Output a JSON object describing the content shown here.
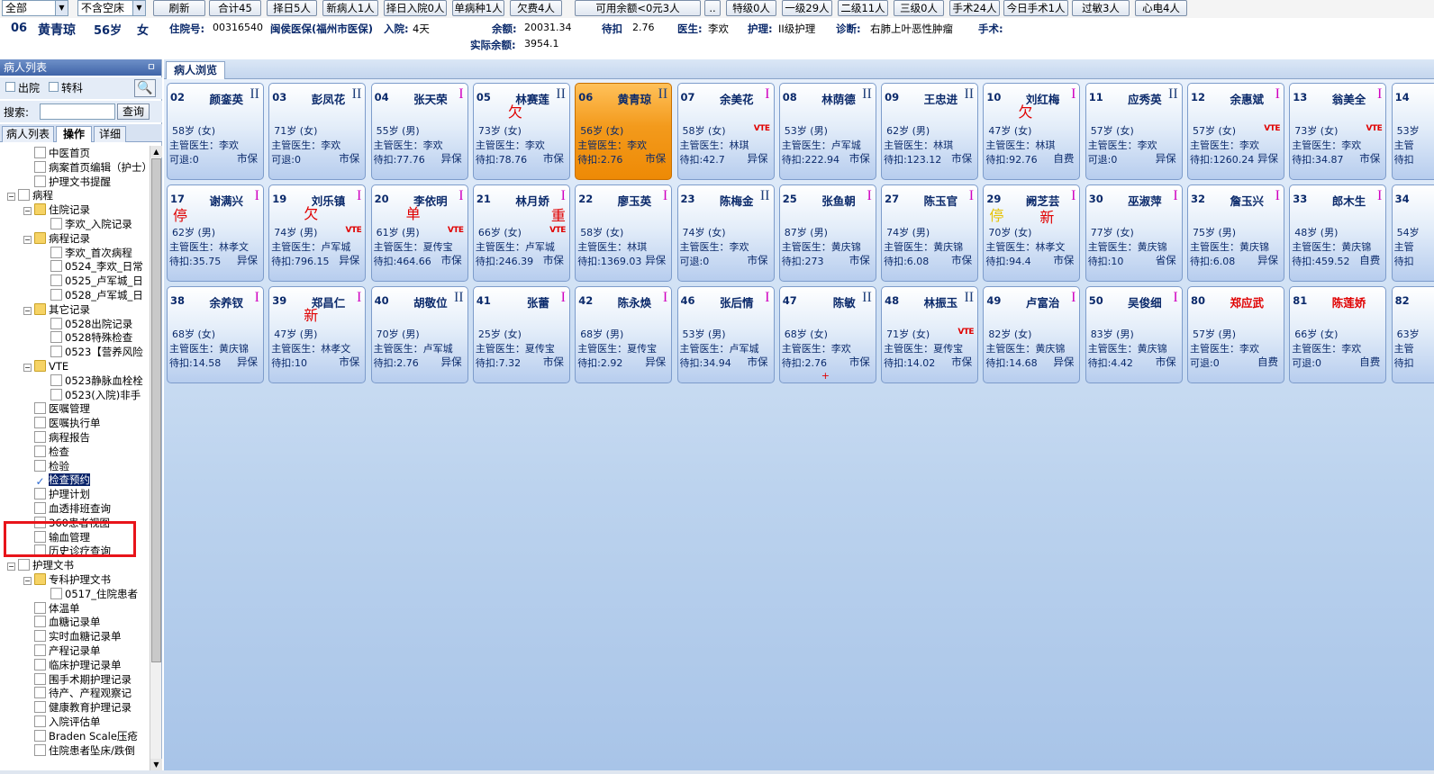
{
  "toolbar": {
    "filter_all": "全部",
    "filter_bed": "不含空床",
    "buttons": [
      "刷新",
      "合计45",
      "择日5人",
      "新病人1人",
      "择日入院0人",
      "单病种1人",
      "欠费4人",
      "可用余额<0元3人",
      "..",
      "特级0人",
      "一级29人",
      "二级11人",
      "三级0人",
      "手术24人",
      "今日手术1人",
      "过敏3人",
      "心电4人"
    ]
  },
  "patient_info": {
    "bed": "06",
    "name": "黄青琼",
    "age": "56岁",
    "sex": "女",
    "admission_label": "住院号:",
    "admission_no": "00316540",
    "insurance": "闽侯医保(福州市医保)",
    "admit_label": "入院:",
    "admit_days": "4天",
    "balance_label": "余额:",
    "balance": "20031.34",
    "actual_balance_label": "实际余额:",
    "actual_balance": "3954.1",
    "pending_label": "待扣",
    "pending": "2.76",
    "doctor_label": "医生:",
    "doctor": "李欢",
    "nursing_label": "护理:",
    "nursing": "II级护理",
    "diagnosis_label": "诊断:",
    "diagnosis": "右肺上叶恶性肿瘤",
    "surgery_label": "手术:"
  },
  "left_panel": {
    "title": "病人列表",
    "pin": "ㅁ",
    "discharged": "出院",
    "transferred": "转科",
    "search_label": "搜索:",
    "search_button": "查询",
    "tabs": [
      "病人列表",
      "操作",
      "详细"
    ],
    "tree": [
      {
        "label": "中医首页",
        "exp": ""
      },
      {
        "label": "病案首页编辑（护士）",
        "exp": ""
      },
      {
        "label": "护理文书提醒",
        "exp": ""
      },
      {
        "label": "病程",
        "exp": "−"
      },
      {
        "label": "住院记录",
        "exp": "−"
      },
      {
        "label": "李欢_入院记录",
        "exp": ""
      },
      {
        "label": "病程记录",
        "exp": "−"
      },
      {
        "label": "李欢_首次病程",
        "exp": ""
      },
      {
        "label": "0524_李欢_日常",
        "exp": ""
      },
      {
        "label": "0525_卢军城_日",
        "exp": ""
      },
      {
        "label": "0528_卢军城_日",
        "exp": ""
      },
      {
        "label": "其它记录",
        "exp": "−"
      },
      {
        "label": "0528出院记录",
        "exp": ""
      },
      {
        "label": "0528特殊检查",
        "exp": ""
      },
      {
        "label": "0523【营养风险",
        "exp": ""
      },
      {
        "label": "VTE",
        "exp": "−"
      },
      {
        "label": "0523静脉血栓栓",
        "exp": ""
      },
      {
        "label": "0523(入院)非手",
        "exp": ""
      },
      {
        "label": "医嘱管理",
        "exp": ""
      },
      {
        "label": "医嘱执行单",
        "exp": ""
      },
      {
        "label": "病程报告",
        "exp": ""
      },
      {
        "label": "检查",
        "exp": ""
      },
      {
        "label": "检验",
        "exp": ""
      },
      {
        "label": "检查预约",
        "exp": ""
      },
      {
        "label": "护理计划",
        "exp": ""
      },
      {
        "label": "血透排班查询",
        "exp": ""
      },
      {
        "label": "360患者视图",
        "exp": ""
      },
      {
        "label": "输血管理",
        "exp": ""
      },
      {
        "label": "历史诊疗查询",
        "exp": ""
      },
      {
        "label": "护理文书",
        "exp": "−"
      },
      {
        "label": "专科护理文书",
        "exp": "−"
      },
      {
        "label": "0517_住院患者",
        "exp": ""
      },
      {
        "label": "体温单",
        "exp": ""
      },
      {
        "label": "血糖记录单",
        "exp": ""
      },
      {
        "label": "实时血糖记录单",
        "exp": ""
      },
      {
        "label": "产程记录单",
        "exp": ""
      },
      {
        "label": "临床护理记录单",
        "exp": ""
      },
      {
        "label": "围手术期护理记录",
        "exp": ""
      },
      {
        "label": "待产、产程观察记",
        "exp": ""
      },
      {
        "label": "健康教育护理记录",
        "exp": ""
      },
      {
        "label": "入院评估单",
        "exp": ""
      },
      {
        "label": "Braden Scale压疮",
        "exp": ""
      },
      {
        "label": "住院患者坠床/跌倒",
        "exp": ""
      }
    ]
  },
  "main": {
    "tab": "病人浏览",
    "cards": [
      {
        "bed": "02",
        "name": "颜銮英",
        "level": "II",
        "age": "58岁 (女)",
        "doctor": "主管医生：李欢",
        "acc": "可退:0",
        "ins": "市保",
        "vte": "",
        "flags": []
      },
      {
        "bed": "03",
        "name": "彭凤花",
        "level": "II",
        "age": "71岁 (女)",
        "doctor": "主管医生：李欢",
        "acc": "可退:0",
        "ins": "市保",
        "vte": "",
        "flags": []
      },
      {
        "bed": "04",
        "name": "张天荣",
        "level": "I",
        "age": "55岁 (男)",
        "doctor": "主管医生：李欢",
        "acc": "待扣:77.76",
        "ins": "异保",
        "vte": "",
        "flags": []
      },
      {
        "bed": "05",
        "name": "林赛莲",
        "level": "II",
        "age": "73岁 (女)",
        "doctor": "主管医生：李欢",
        "acc": "待扣:78.76",
        "ins": "市保",
        "vte": "",
        "flags": [
          {
            "t": "欠",
            "c": "r",
            "p": "mid"
          }
        ]
      },
      {
        "bed": "06",
        "name": "黄青琼",
        "level": "II",
        "age": "56岁 (女)",
        "doctor": "主管医生：李欢",
        "acc": "待扣:2.76",
        "ins": "市保",
        "vte": "",
        "flags": [],
        "active": true
      },
      {
        "bed": "07",
        "name": "余美花",
        "level": "I",
        "age": "58岁 (女)",
        "doctor": "主管医生：林琪",
        "acc": "待扣:42.7",
        "ins": "异保",
        "vte": "VTE",
        "flags": []
      },
      {
        "bed": "08",
        "name": "林荫德",
        "level": "II",
        "age": "53岁 (男)",
        "doctor": "主管医生：卢军城",
        "acc": "待扣:222.94",
        "ins": "市保",
        "vte": "",
        "flags": []
      },
      {
        "bed": "09",
        "name": "王忠进",
        "level": "II",
        "age": "62岁 (男)",
        "doctor": "主管医生：林琪",
        "acc": "待扣:123.12",
        "ins": "市保",
        "vte": "",
        "flags": []
      },
      {
        "bed": "10",
        "name": "刘红梅",
        "level": "I",
        "age": "47岁 (女)",
        "doctor": "主管医生：林琪",
        "acc": "待扣:92.76",
        "ins": "自费",
        "vte": "",
        "flags": [
          {
            "t": "欠",
            "c": "r",
            "p": "mid"
          }
        ]
      },
      {
        "bed": "11",
        "name": "应秀英",
        "level": "II",
        "age": "57岁 (女)",
        "doctor": "主管医生：李欢",
        "acc": "可退:0",
        "ins": "异保",
        "vte": "",
        "flags": []
      },
      {
        "bed": "12",
        "name": "余惠斌",
        "level": "I",
        "age": "57岁 (女)",
        "doctor": "主管医生：李欢",
        "acc": "待扣:1260.24",
        "ins": "异保",
        "vte": "VTE",
        "flags": []
      },
      {
        "bed": "13",
        "name": "翁美全",
        "level": "I",
        "age": "73岁 (女)",
        "doctor": "主管医生：李欢",
        "acc": "待扣:34.87",
        "ins": "市保",
        "vte": "VTE",
        "flags": []
      },
      {
        "bed": "14",
        "name": "",
        "level": "",
        "age": "53岁",
        "doctor": "主管",
        "acc": "待扣",
        "ins": "",
        "vte": "",
        "flags": []
      },
      {
        "bed": "17",
        "name": "谢满兴",
        "level": "I",
        "age": "62岁 (男)",
        "doctor": "主管医生：林孝文",
        "acc": "待扣:35.75",
        "ins": "异保",
        "vte": "",
        "flags": [
          {
            "t": "停",
            "c": "r",
            "p": "left"
          }
        ]
      },
      {
        "bed": "19",
        "name": "刘乐镇",
        "level": "I",
        "age": "74岁 (男)",
        "doctor": "主管医生：卢军城",
        "acc": "待扣:796.15",
        "ins": "异保",
        "vte": "VTE",
        "flags": [
          {
            "t": "欠",
            "c": "r",
            "p": "mid"
          }
        ]
      },
      {
        "bed": "20",
        "name": "李依明",
        "level": "I",
        "age": "61岁 (男)",
        "doctor": "主管医生：夏传宝",
        "acc": "待扣:464.66",
        "ins": "市保",
        "vte": "VTE",
        "flags": [
          {
            "t": "单",
            "c": "r",
            "p": "mid"
          }
        ]
      },
      {
        "bed": "21",
        "name": "林月娇",
        "level": "I",
        "age": "66岁 (女)",
        "doctor": "主管医生：卢军城",
        "acc": "待扣:246.39",
        "ins": "市保",
        "vte": "VTE",
        "flags": [
          {
            "t": "重",
            "c": "r",
            "p": "right"
          }
        ]
      },
      {
        "bed": "22",
        "name": "廖玉英",
        "level": "I",
        "age": "58岁 (女)",
        "doctor": "主管医生：林琪",
        "acc": "待扣:1369.03",
        "ins": "异保",
        "vte": "",
        "flags": []
      },
      {
        "bed": "23",
        "name": "陈梅金",
        "level": "II",
        "age": "74岁 (女)",
        "doctor": "主管医生：李欢",
        "acc": "可退:0",
        "ins": "市保",
        "vte": "",
        "flags": []
      },
      {
        "bed": "25",
        "name": "张鱼朝",
        "level": "I",
        "age": "87岁 (男)",
        "doctor": "主管医生：黄庆锦",
        "acc": "待扣:273",
        "ins": "市保",
        "vte": "",
        "flags": []
      },
      {
        "bed": "27",
        "name": "陈玉官",
        "level": "I",
        "age": "74岁 (男)",
        "doctor": "主管医生：黄庆锦",
        "acc": "待扣:6.08",
        "ins": "市保",
        "vte": "",
        "flags": []
      },
      {
        "bed": "29",
        "name": "阙芝芸",
        "level": "I",
        "age": "70岁 (女)",
        "doctor": "主管医生：林孝文",
        "acc": "待扣:94.4",
        "ins": "市保",
        "vte": "",
        "flags": [
          {
            "t": "停",
            "c": "y",
            "p": "left"
          },
          {
            "t": "新",
            "c": "r",
            "p": "right2"
          }
        ]
      },
      {
        "bed": "30",
        "name": "巫淑萍",
        "level": "I",
        "age": "77岁 (女)",
        "doctor": "主管医生：黄庆锦",
        "acc": "待扣:10",
        "ins": "省保",
        "vte": "",
        "flags": []
      },
      {
        "bed": "32",
        "name": "詹玉兴",
        "level": "I",
        "age": "75岁 (男)",
        "doctor": "主管医生：黄庆锦",
        "acc": "待扣:6.08",
        "ins": "异保",
        "vte": "",
        "flags": []
      },
      {
        "bed": "33",
        "name": "郎木生",
        "level": "I",
        "age": "48岁 (男)",
        "doctor": "主管医生：黄庆锦",
        "acc": "待扣:459.52",
        "ins": "自费",
        "vte": "",
        "flags": []
      },
      {
        "bed": "34",
        "name": "",
        "level": "",
        "age": "54岁",
        "doctor": "主管",
        "acc": "待扣",
        "ins": "",
        "vte": "",
        "flags": []
      },
      {
        "bed": "38",
        "name": "余养钗",
        "level": "I",
        "age": "68岁 (女)",
        "doctor": "主管医生：黄庆锦",
        "acc": "待扣:14.58",
        "ins": "异保",
        "vte": "",
        "flags": []
      },
      {
        "bed": "39",
        "name": "郑昌仁",
        "level": "I",
        "age": "47岁 (男)",
        "doctor": "主管医生：林孝文",
        "acc": "待扣:10",
        "ins": "市保",
        "vte": "",
        "flags": [
          {
            "t": "新",
            "c": "r",
            "p": "mid"
          }
        ]
      },
      {
        "bed": "40",
        "name": "胡敬位",
        "level": "II",
        "age": "70岁 (男)",
        "doctor": "主管医生：卢军城",
        "acc": "待扣:2.76",
        "ins": "异保",
        "vte": "",
        "flags": []
      },
      {
        "bed": "41",
        "name": "张蕾",
        "level": "I",
        "age": "25岁 (女)",
        "doctor": "主管医生：夏传宝",
        "acc": "待扣:7.32",
        "ins": "市保",
        "vte": "",
        "flags": []
      },
      {
        "bed": "42",
        "name": "陈永焕",
        "level": "I",
        "age": "68岁 (男)",
        "doctor": "主管医生：夏传宝",
        "acc": "待扣:2.92",
        "ins": "异保",
        "vte": "",
        "flags": []
      },
      {
        "bed": "46",
        "name": "张后情",
        "level": "I",
        "age": "53岁 (男)",
        "doctor": "主管医生：卢军城",
        "acc": "待扣:34.94",
        "ins": "市保",
        "vte": "",
        "flags": []
      },
      {
        "bed": "47",
        "name": "陈敏",
        "level": "II",
        "age": "68岁 (女)",
        "doctor": "主管医生：李欢",
        "acc": "待扣:2.76",
        "ins": "市保",
        "vte": "",
        "flags": [],
        "tick": "+"
      },
      {
        "bed": "48",
        "name": "林振玉",
        "level": "II",
        "age": "71岁 (女)",
        "doctor": "主管医生：夏传宝",
        "acc": "待扣:14.02",
        "ins": "市保",
        "vte": "VTE",
        "flags": []
      },
      {
        "bed": "49",
        "name": "卢富治",
        "level": "I",
        "age": "82岁 (女)",
        "doctor": "主管医生：黄庆锦",
        "acc": "待扣:14.68",
        "ins": "异保",
        "vte": "",
        "flags": []
      },
      {
        "bed": "50",
        "name": "吴俊细",
        "level": "I",
        "age": "83岁 (男)",
        "doctor": "主管医生：黄庆锦",
        "acc": "待扣:4.42",
        "ins": "市保",
        "vte": "",
        "flags": []
      },
      {
        "bed": "80",
        "name": "郑应武",
        "level": "",
        "age": "57岁 (男)",
        "doctor": "主管医生：李欢",
        "acc": "可退:0",
        "ins": "自费",
        "vte": "",
        "flags": [],
        "redname": true
      },
      {
        "bed": "81",
        "name": "陈莲娇",
        "level": "",
        "age": "66岁 (女)",
        "doctor": "主管医生：李欢",
        "acc": "可退:0",
        "ins": "自费",
        "vte": "",
        "flags": [],
        "redname": true
      },
      {
        "bed": "82",
        "name": "",
        "level": "",
        "age": "63岁",
        "doctor": "主管",
        "acc": "待扣",
        "ins": "",
        "vte": "",
        "flags": []
      }
    ]
  }
}
